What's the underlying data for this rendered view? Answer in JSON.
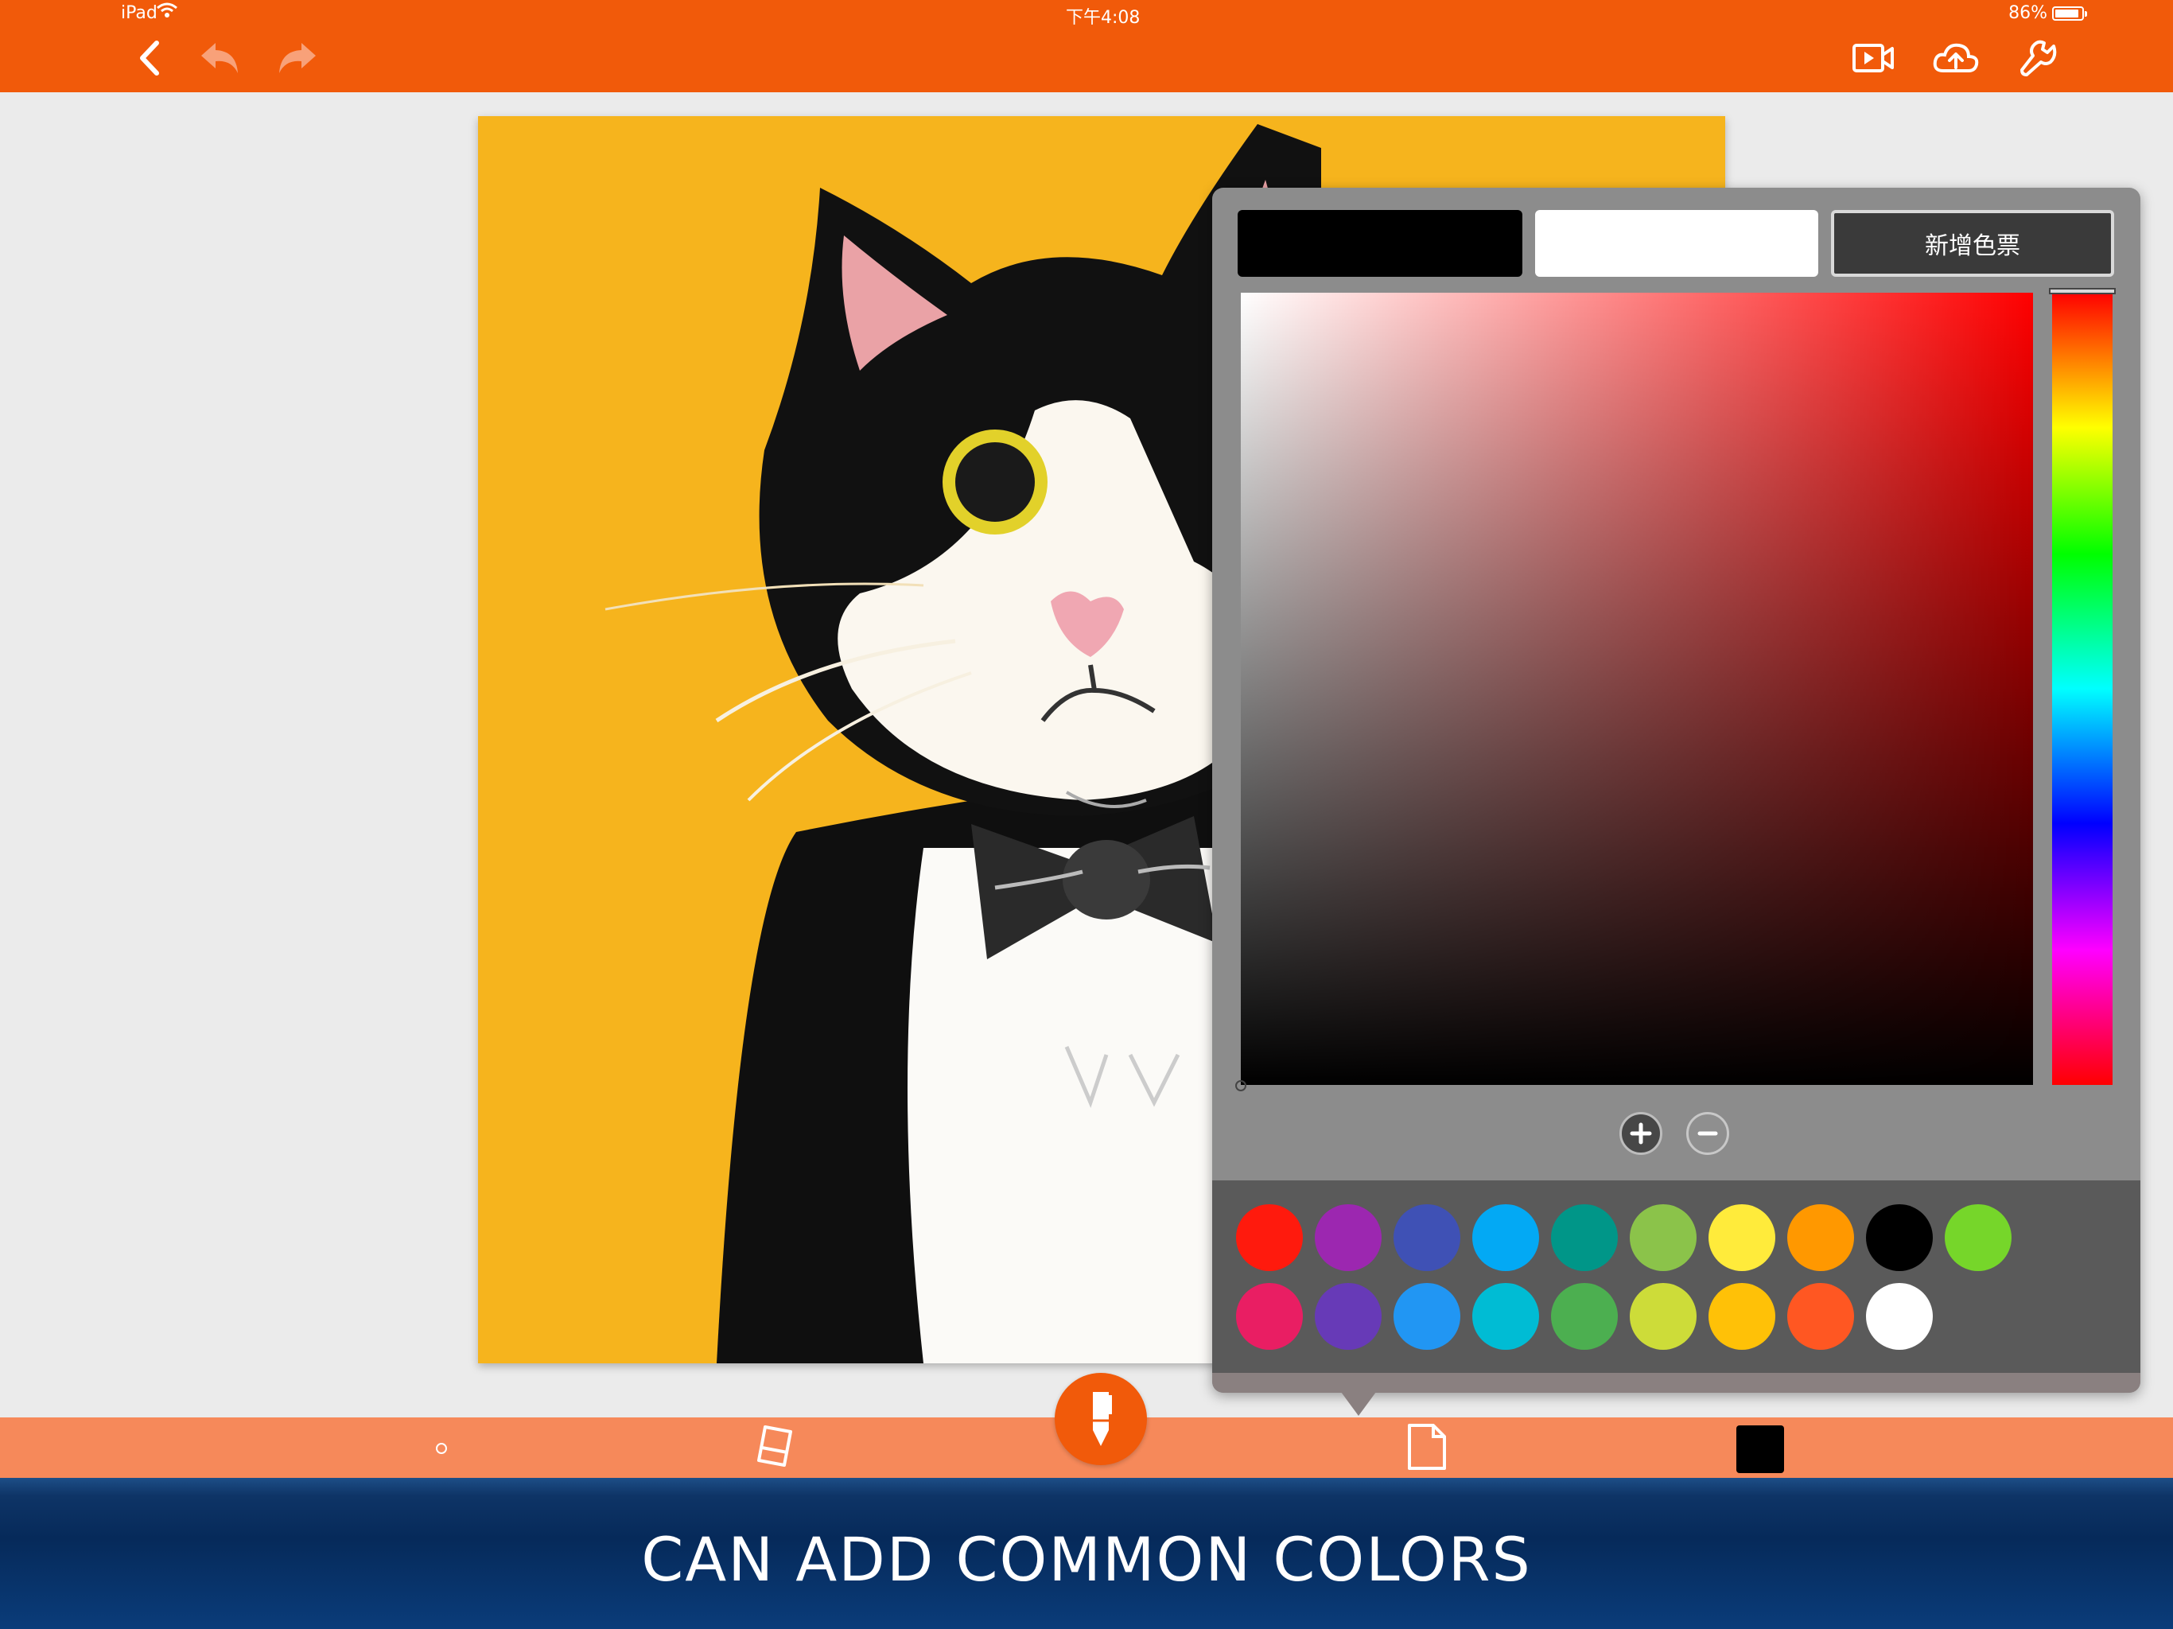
{
  "status_bar": {
    "device": "iPad",
    "time": "下午4:08",
    "battery": "86%",
    "battery_level": 0.86
  },
  "toolbar_top": {
    "icons": [
      "back-chevron-icon",
      "undo-icon",
      "redo-icon",
      "record-video-icon",
      "cloud-upload-icon",
      "wrench-icon"
    ]
  },
  "color_picker": {
    "current_color": "#000000",
    "previous_color": "#ffffff",
    "add_swatch_label": "新增色票",
    "hue_base": "#ff0000",
    "add_label": "+",
    "remove_label": "−",
    "palette": [
      "#ff1a0d",
      "#9c27b0",
      "#3f51b5",
      "#03a9f4",
      "#009688",
      "#8bc34a",
      "#ffeb3b",
      "#ff9800",
      "#000000",
      "#76d62a",
      "#e91e63",
      "#673ab7",
      "#2196f3",
      "#00bcd4",
      "#4caf50",
      "#cddc39",
      "#ffc107",
      "#ff5722",
      "#ffffff"
    ]
  },
  "bottom_toolbar": {
    "icons": [
      "page-dot-icon",
      "eraser-icon",
      "pen-icon",
      "layers-icon",
      "color-chip"
    ],
    "selected_color": "#000000"
  },
  "caption": "CAN ADD COMMON COLORS",
  "colors": {
    "accent": "#f15a0a",
    "bottom_bar": "#f6895a",
    "banner": "#062a5a",
    "artwork_bg": "#f6b41d"
  }
}
